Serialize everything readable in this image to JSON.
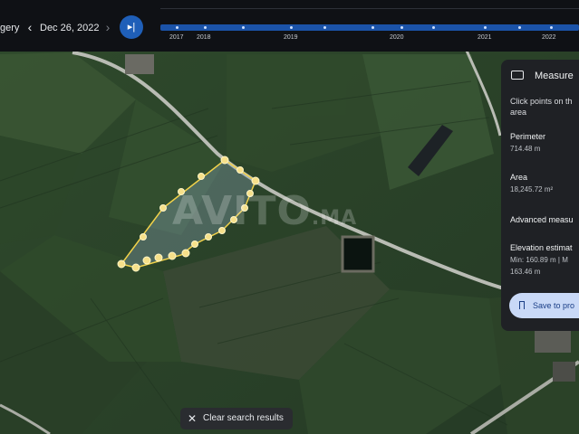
{
  "topbar": {
    "imagery_label": "gery",
    "prev_icon": "chevron-left-icon",
    "date": "Dec 26, 2022",
    "next_icon": "chevron-right-icon",
    "latest_icon": "skip-to-latest-icon",
    "latest_glyph": "▸|",
    "years": [
      "2017",
      "2018",
      "2019",
      "2020",
      "2021",
      "2022"
    ]
  },
  "measure": {
    "title": "Measure",
    "icon": "ruler-icon",
    "instruction_line1": "Click points on th",
    "instruction_line2": "area",
    "perimeter_label": "Perimeter",
    "perimeter_value": "714.48 m",
    "area_label": "Area",
    "area_value": "18,245.72 m²",
    "advanced_label": "Advanced measu",
    "elevation_label": "Elevation estimat",
    "elevation_line1": "Min: 160.89 m | M",
    "elevation_line2": "163.46 m",
    "save_label": "Save to pro",
    "save_icon": "bookmark-icon"
  },
  "chip": {
    "close_icon": "close-icon",
    "label": "Clear search results"
  },
  "watermark": {
    "main": "AVITO",
    "suffix": ".MA"
  },
  "colors": {
    "accent": "#1f5fb8",
    "polygon": "#f3d34a",
    "panel": "#1f2125"
  }
}
